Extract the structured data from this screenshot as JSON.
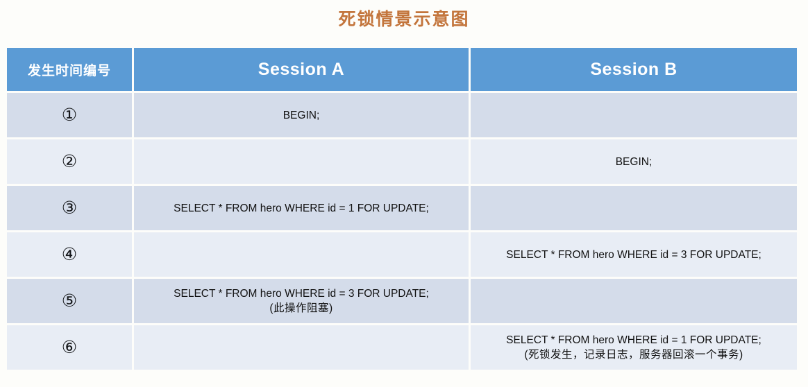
{
  "page": {
    "title": "死锁情景示意图",
    "title_color": "#c3753c",
    "background_color": "#fdfdfa"
  },
  "table": {
    "header_background": "#5b9bd5",
    "header_text_color": "#ffffff",
    "row_odd_background": "#d4dcea",
    "row_even_background": "#e8edf5",
    "columns": [
      {
        "key": "num",
        "label": "发生时间编号"
      },
      {
        "key": "session_a",
        "label": "Session A"
      },
      {
        "key": "session_b",
        "label": "Session B"
      }
    ],
    "rows": [
      {
        "num": "①",
        "session_a": [
          "BEGIN;"
        ],
        "session_b": []
      },
      {
        "num": "②",
        "session_a": [],
        "session_b": [
          "BEGIN;"
        ]
      },
      {
        "num": "③",
        "session_a": [
          "SELECT * FROM hero WHERE id = 1 FOR UPDATE;"
        ],
        "session_b": []
      },
      {
        "num": "④",
        "session_a": [],
        "session_b": [
          "SELECT * FROM hero WHERE id = 3 FOR UPDATE;"
        ]
      },
      {
        "num": "⑤",
        "session_a": [
          "SELECT * FROM hero WHERE id = 3 FOR UPDATE;",
          "(此操作阻塞)"
        ],
        "session_b": []
      },
      {
        "num": "⑥",
        "session_a": [],
        "session_b": [
          "SELECT * FROM hero WHERE id = 1 FOR UPDATE;",
          "(死锁发生，记录日志，服务器回滚一个事务)"
        ]
      }
    ]
  }
}
